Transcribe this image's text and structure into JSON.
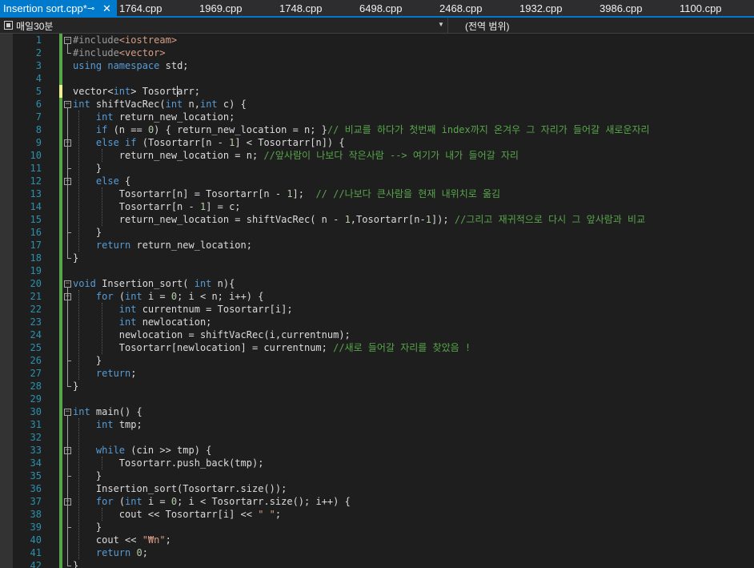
{
  "tabs": [
    {
      "label": "Insertion sort.cpp*",
      "active": true,
      "pinned": true
    },
    {
      "label": "1764.cpp"
    },
    {
      "label": "1969.cpp"
    },
    {
      "label": "1748.cpp"
    },
    {
      "label": "6498.cpp"
    },
    {
      "label": "2468.cpp"
    },
    {
      "label": "1932.cpp"
    },
    {
      "label": "3986.cpp"
    },
    {
      "label": "1100.cpp"
    }
  ],
  "navbar": {
    "scope_label": "매일30분",
    "member_label": "(전역 범위)",
    "scope_icon": "project-icon",
    "dropdown_icon": "chevron-down-icon"
  },
  "colors": {
    "accent": "#007acc",
    "keyword": "#569cd6",
    "comment": "#57a64a",
    "string": "#d69d85",
    "number": "#b5cea8",
    "line_number": "#2b91af",
    "background": "#1e1e1e"
  },
  "line_numbers": [
    "1",
    "2",
    "3",
    "4",
    "5",
    "6",
    "7",
    "8",
    "9",
    "10",
    "11",
    "12",
    "13",
    "14",
    "15",
    "16",
    "17",
    "18",
    "19",
    "20",
    "21",
    "22",
    "23",
    "24",
    "25",
    "26",
    "27",
    "28",
    "29",
    "30",
    "31",
    "32",
    "33",
    "34",
    "35",
    "36",
    "37",
    "38",
    "39",
    "40",
    "41",
    "42"
  ],
  "code_lines": [
    [
      [
        "pp",
        "#include"
      ],
      [
        "inc",
        "<iostream>"
      ]
    ],
    [
      [
        "pp",
        "#include"
      ],
      [
        "inc",
        "<vector>"
      ]
    ],
    [
      [
        "k",
        "using"
      ],
      [
        "t",
        " "
      ],
      [
        "k",
        "namespace"
      ],
      [
        "t",
        " std;"
      ]
    ],
    [],
    [
      [
        "t",
        "vector<"
      ],
      [
        "k",
        "int"
      ],
      [
        "t",
        "> Tosortarr;"
      ]
    ],
    [
      [
        "k",
        "int"
      ],
      [
        "t",
        " shiftVacRec("
      ],
      [
        "k",
        "int"
      ],
      [
        "t",
        " n,"
      ],
      [
        "k",
        "int"
      ],
      [
        "t",
        " c) {"
      ]
    ],
    [
      [
        "t",
        "    "
      ],
      [
        "k",
        "int"
      ],
      [
        "t",
        " return_new_location;"
      ]
    ],
    [
      [
        "t",
        "    "
      ],
      [
        "k",
        "if"
      ],
      [
        "t",
        " (n == "
      ],
      [
        "num",
        "0"
      ],
      [
        "t",
        ") { return_new_location = n; }"
      ],
      [
        "cm",
        "// 비교를 하다가 첫번째 index까지 온겨우 그 자리가 들어갈 새로운자리"
      ]
    ],
    [
      [
        "t",
        "    "
      ],
      [
        "k",
        "else"
      ],
      [
        "t",
        " "
      ],
      [
        "k",
        "if"
      ],
      [
        "t",
        " (Tosortarr[n - "
      ],
      [
        "num",
        "1"
      ],
      [
        "t",
        "] < Tosortarr[n]) {"
      ]
    ],
    [
      [
        "t",
        "        return_new_location = n; "
      ],
      [
        "cm",
        "//앞사람이 나보다 작은사람 --> 여기가 내가 들어갈 자리"
      ]
    ],
    [
      [
        "t",
        "    }"
      ]
    ],
    [
      [
        "t",
        "    "
      ],
      [
        "k",
        "else"
      ],
      [
        "t",
        " {"
      ]
    ],
    [
      [
        "t",
        "        Tosortarr[n] = Tosortarr[n - "
      ],
      [
        "num",
        "1"
      ],
      [
        "t",
        "];  "
      ],
      [
        "cm",
        "// //나보다 큰사람을 현재 내위치로 옮김"
      ]
    ],
    [
      [
        "t",
        "        Tosortarr[n - "
      ],
      [
        "num",
        "1"
      ],
      [
        "t",
        "] = c;"
      ]
    ],
    [
      [
        "t",
        "        return_new_location = shiftVacRec( n - "
      ],
      [
        "num",
        "1"
      ],
      [
        "t",
        ",Tosortarr[n-"
      ],
      [
        "num",
        "1"
      ],
      [
        "t",
        "]); "
      ],
      [
        "cm",
        "//그리고 재귀적으로 다시 그 앞사람과 비교"
      ]
    ],
    [
      [
        "t",
        "    }"
      ]
    ],
    [
      [
        "t",
        "    "
      ],
      [
        "k",
        "return"
      ],
      [
        "t",
        " return_new_location;"
      ]
    ],
    [
      [
        "t",
        "}"
      ]
    ],
    [],
    [
      [
        "k",
        "void"
      ],
      [
        "t",
        " Insertion_sort( "
      ],
      [
        "k",
        "int"
      ],
      [
        "t",
        " n){"
      ]
    ],
    [
      [
        "t",
        "    "
      ],
      [
        "k",
        "for"
      ],
      [
        "t",
        " ("
      ],
      [
        "k",
        "int"
      ],
      [
        "t",
        " i = "
      ],
      [
        "num",
        "0"
      ],
      [
        "t",
        "; i < n; i++) {"
      ]
    ],
    [
      [
        "t",
        "        "
      ],
      [
        "k",
        "int"
      ],
      [
        "t",
        " currentnum = Tosortarr[i];"
      ]
    ],
    [
      [
        "t",
        "        "
      ],
      [
        "k",
        "int"
      ],
      [
        "t",
        " newlocation;"
      ]
    ],
    [
      [
        "t",
        "        newlocation = shiftVacRec(i,currentnum);"
      ]
    ],
    [
      [
        "t",
        "        Tosortarr[newlocation] = currentnum; "
      ],
      [
        "cm",
        "//새로 들어갈 자리를 찾았음 !"
      ]
    ],
    [
      [
        "t",
        "    }"
      ]
    ],
    [
      [
        "t",
        "    "
      ],
      [
        "k",
        "return"
      ],
      [
        "t",
        ";"
      ]
    ],
    [
      [
        "t",
        "}"
      ]
    ],
    [],
    [
      [
        "k",
        "int"
      ],
      [
        "t",
        " main() {"
      ]
    ],
    [
      [
        "t",
        "    "
      ],
      [
        "k",
        "int"
      ],
      [
        "t",
        " tmp;"
      ]
    ],
    [],
    [
      [
        "t",
        "    "
      ],
      [
        "k",
        "while"
      ],
      [
        "t",
        " (cin >> tmp) {"
      ]
    ],
    [
      [
        "t",
        "        Tosortarr.push_back(tmp);"
      ]
    ],
    [
      [
        "t",
        "    }"
      ]
    ],
    [
      [
        "t",
        "    Insertion_sort(Tosortarr.size());"
      ]
    ],
    [
      [
        "t",
        "    "
      ],
      [
        "k",
        "for"
      ],
      [
        "t",
        " ("
      ],
      [
        "k",
        "int"
      ],
      [
        "t",
        " i = "
      ],
      [
        "num",
        "0"
      ],
      [
        "t",
        "; i < Tosortarr.size(); i++) {"
      ]
    ],
    [
      [
        "t",
        "        cout << Tosortarr[i] << "
      ],
      [
        "str",
        "\" \""
      ],
      [
        "t",
        ";"
      ]
    ],
    [
      [
        "t",
        "    }"
      ]
    ],
    [
      [
        "t",
        "    cout << "
      ],
      [
        "str",
        "\"₩n\""
      ],
      [
        "t",
        ";"
      ]
    ],
    [
      [
        "t",
        "    "
      ],
      [
        "k",
        "return"
      ],
      [
        "t",
        " "
      ],
      [
        "num",
        "0"
      ],
      [
        "t",
        ";"
      ]
    ],
    [
      [
        "t",
        "}"
      ]
    ]
  ]
}
